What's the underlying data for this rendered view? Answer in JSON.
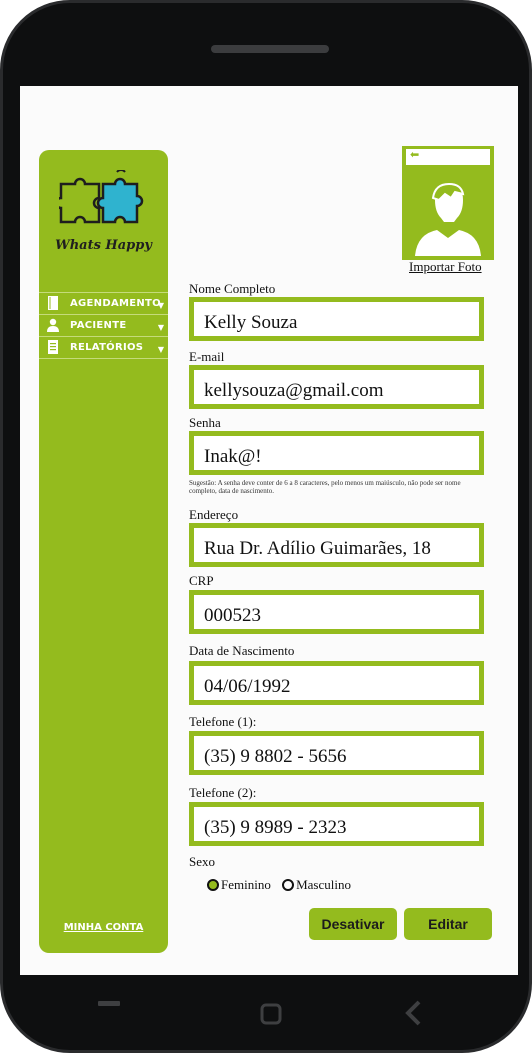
{
  "app": {
    "logo_text": "Whats Happy",
    "brand_color": "#94bb1e"
  },
  "sidebar": {
    "items": [
      {
        "label": "AGENDAMENTO",
        "icon": "book-icon"
      },
      {
        "label": "PACIENTE",
        "icon": "user-icon"
      },
      {
        "label": "RELATÓRIOS",
        "icon": "document-icon"
      }
    ],
    "account_link": "MINHA CONTA"
  },
  "photo": {
    "import_label": "Importar Foto",
    "back_icon": "back-arrow-icon"
  },
  "form": {
    "name_label": "Nome Completo",
    "name_value": "Kelly Souza",
    "email_label": "E-mail",
    "email_value": "kellysouza@gmail.com",
    "password_label": "Senha",
    "password_value": "Inak@!",
    "password_hint": "Sugestão: A senha deve conter de 6 a 8 caracteres, pelo menos um maiúsculo, não pode ser nome completo, data de nascimento.",
    "address_label": "Endereço",
    "address_value": "Rua Dr. Adílio Guimarães, 18",
    "crp_label": "CRP",
    "crp_value": "000523",
    "birth_label": "Data de Nascimento",
    "birth_value": "04/06/1992",
    "phone1_label": "Telefone (1):",
    "phone1_value": "(35) 9 8802 - 5656",
    "phone2_label": "Telefone (2):",
    "phone2_value": "(35) 9 8989 - 2323",
    "sex_label": "Sexo",
    "sex_options": [
      "Feminino",
      "Masculino"
    ],
    "sex_selected": "Feminino"
  },
  "buttons": {
    "deactivate": "Desativar",
    "edit": "Editar"
  },
  "android_nav": [
    "recents-icon",
    "home-icon",
    "back-icon"
  ]
}
